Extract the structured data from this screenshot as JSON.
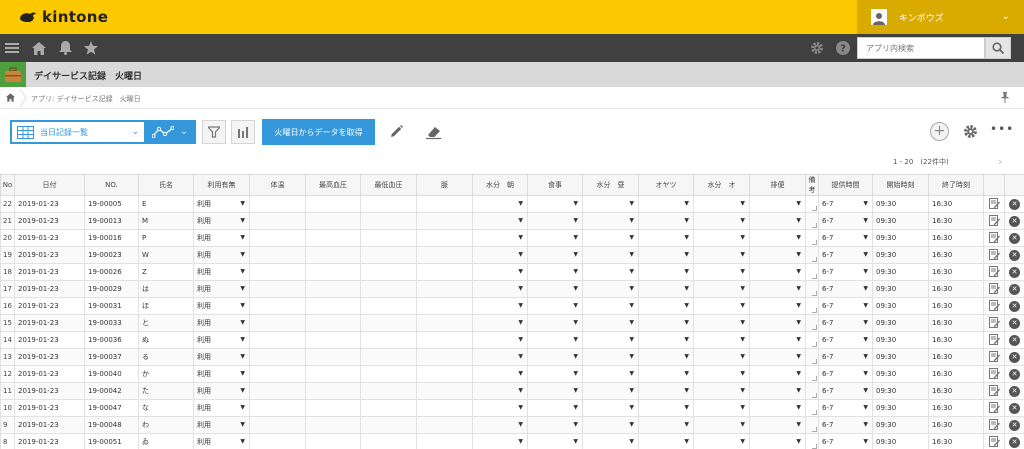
{
  "brand": {
    "logo_text": "kintone"
  },
  "user": {
    "name": "キンボウズ"
  },
  "search": {
    "placeholder": "アプリ内検索"
  },
  "app": {
    "title": "デイサービス記録　火曜日"
  },
  "breadcrumb": {
    "text": "アプリ: デイサービス記録　火曜日"
  },
  "toolbar": {
    "view_label": "当日記録一覧",
    "fetch_label": "火曜日からデータを取得",
    "add_label": "+"
  },
  "pagination": {
    "text": "1 - 20　(22件中)"
  },
  "colors": {
    "header_yellow": "#fcc800",
    "nav_dark": "#404040",
    "accent_blue": "#3498db"
  },
  "table": {
    "columns": [
      "No",
      "日付",
      "NO.",
      "氏名",
      "利用有無",
      "体温",
      "最高血圧",
      "最低血圧",
      "脈",
      "水分　朝",
      "食事",
      "水分　昼",
      "オヤツ",
      "水分　オ",
      "排便",
      "備考",
      "提供時間",
      "開始時刻",
      "終了時刻"
    ],
    "rows": [
      {
        "no": "22",
        "date": "2019-01-23",
        "id": "19-00005",
        "name": "E",
        "use": "利用",
        "time": "6-7",
        "start": "09:30",
        "end": "16:30"
      },
      {
        "no": "21",
        "date": "2019-01-23",
        "id": "19-00013",
        "name": "M",
        "use": "利用",
        "time": "6-7",
        "start": "09:30",
        "end": "16:30"
      },
      {
        "no": "20",
        "date": "2019-01-23",
        "id": "19-00016",
        "name": "P",
        "use": "利用",
        "time": "6-7",
        "start": "09:30",
        "end": "16:30"
      },
      {
        "no": "19",
        "date": "2019-01-23",
        "id": "19-00023",
        "name": "W",
        "use": "利用",
        "time": "6-7",
        "start": "09:30",
        "end": "16:30"
      },
      {
        "no": "18",
        "date": "2019-01-23",
        "id": "19-00026",
        "name": "Z",
        "use": "利用",
        "time": "6-7",
        "start": "09:30",
        "end": "16:30"
      },
      {
        "no": "17",
        "date": "2019-01-23",
        "id": "19-00029",
        "name": "は",
        "use": "利用",
        "time": "6-7",
        "start": "09:30",
        "end": "16:30"
      },
      {
        "no": "16",
        "date": "2019-01-23",
        "id": "19-00031",
        "name": "ほ",
        "use": "利用",
        "time": "6-7",
        "start": "09:30",
        "end": "16:30"
      },
      {
        "no": "15",
        "date": "2019-01-23",
        "id": "19-00033",
        "name": "と",
        "use": "利用",
        "time": "6-7",
        "start": "09:30",
        "end": "16:30"
      },
      {
        "no": "14",
        "date": "2019-01-23",
        "id": "19-00036",
        "name": "ぬ",
        "use": "利用",
        "time": "6-7",
        "start": "09:30",
        "end": "16:30"
      },
      {
        "no": "13",
        "date": "2019-01-23",
        "id": "19-00037",
        "name": "る",
        "use": "利用",
        "time": "6-7",
        "start": "09:30",
        "end": "16:30"
      },
      {
        "no": "12",
        "date": "2019-01-23",
        "id": "19-00040",
        "name": "か",
        "use": "利用",
        "time": "6-7",
        "start": "09:30",
        "end": "16:30"
      },
      {
        "no": "11",
        "date": "2019-01-23",
        "id": "19-00042",
        "name": "た",
        "use": "利用",
        "time": "6-7",
        "start": "09:30",
        "end": "16:30"
      },
      {
        "no": "10",
        "date": "2019-01-23",
        "id": "19-00047",
        "name": "な",
        "use": "利用",
        "time": "6-7",
        "start": "09:30",
        "end": "16:30"
      },
      {
        "no": "9",
        "date": "2019-01-23",
        "id": "19-00048",
        "name": "わ",
        "use": "利用",
        "time": "6-7",
        "start": "09:30",
        "end": "16:30"
      },
      {
        "no": "8",
        "date": "2019-01-23",
        "id": "19-00051",
        "name": "ゐ",
        "use": "利用",
        "time": "6-7",
        "start": "09:30",
        "end": "16:30"
      }
    ]
  }
}
